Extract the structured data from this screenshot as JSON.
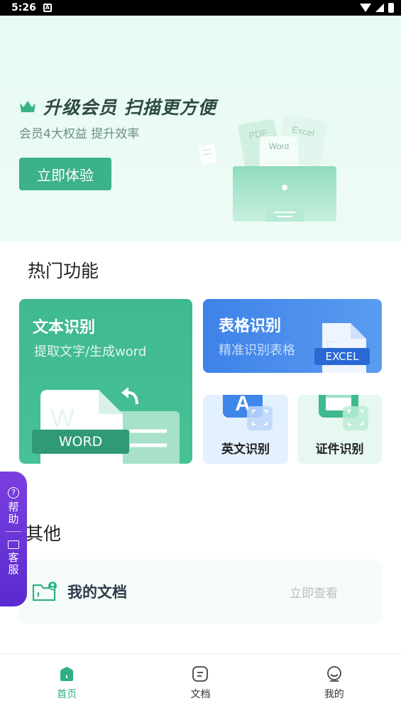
{
  "status_bar": {
    "time": "5:26"
  },
  "banner": {
    "title": "升级会员 扫描更方便",
    "subtitle": "会员4大权益 提升效率",
    "button_label": "立即体验",
    "illustration_labels": {
      "pdf": "PDF",
      "excel": "Excel",
      "word": "Word"
    }
  },
  "hot_section": {
    "title": "热门功能",
    "text_recognition": {
      "title": "文本识别",
      "subtitle": "提取文字/生成word",
      "badge": "WORD"
    },
    "table_recognition": {
      "title": "表格识别",
      "subtitle": "精准识别表格",
      "badge": "EXCEL"
    },
    "english_recognition": {
      "label": "英文识别",
      "icon_letter": "A"
    },
    "id_recognition": {
      "label": "证件识别"
    }
  },
  "other_section": {
    "title": "其他",
    "my_docs": {
      "label": "我的文档",
      "action": "立即查看"
    }
  },
  "side_widget": {
    "help": "帮助",
    "service": "客服"
  },
  "bottom_nav": {
    "items": [
      {
        "label": "首页",
        "active": true
      },
      {
        "label": "文档",
        "active": false
      },
      {
        "label": "我的",
        "active": false
      }
    ]
  },
  "colors": {
    "accent": "#3bb287",
    "blue": "#3e82e8",
    "purple": "#6a35d8"
  }
}
